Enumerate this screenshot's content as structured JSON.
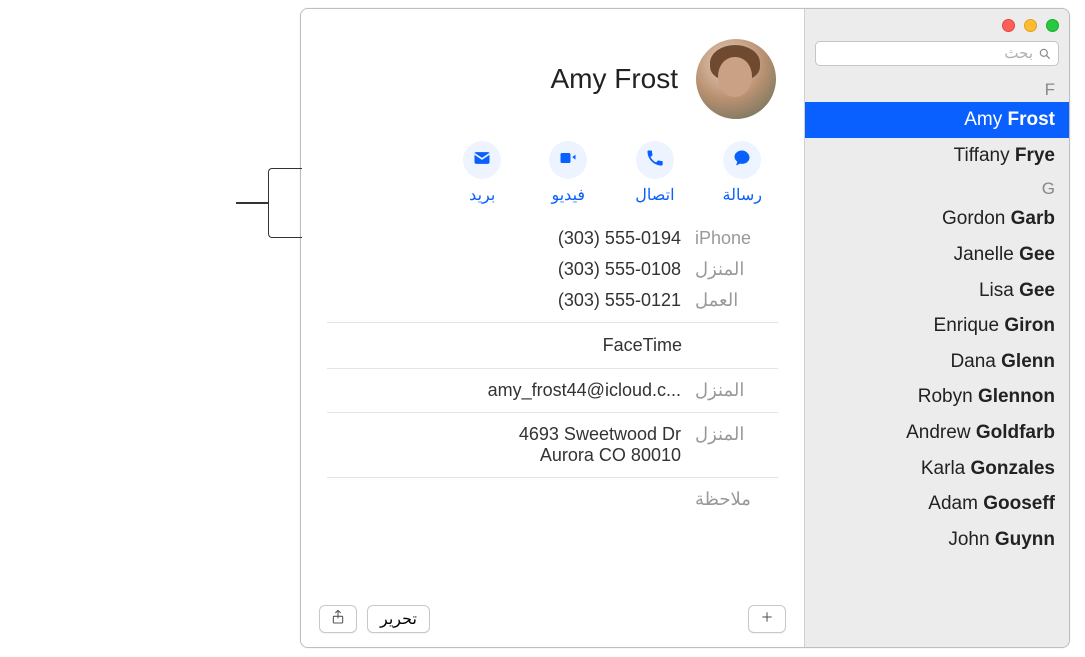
{
  "search": {
    "placeholder": "بحث"
  },
  "sections": [
    {
      "letter": "F",
      "contacts": [
        {
          "first": "Amy",
          "last": "Frost",
          "selected": true
        },
        {
          "first": "Tiffany",
          "last": "Frye",
          "selected": false
        }
      ]
    },
    {
      "letter": "G",
      "contacts": [
        {
          "first": "Gordon",
          "last": "Garb"
        },
        {
          "first": "Janelle",
          "last": "Gee"
        },
        {
          "first": "Lisa",
          "last": "Gee"
        },
        {
          "first": "Enrique",
          "last": "Giron"
        },
        {
          "first": "Dana",
          "last": "Glenn"
        },
        {
          "first": "Robyn",
          "last": "Glennon"
        },
        {
          "first": "Andrew",
          "last": "Goldfarb"
        },
        {
          "first": "Karla",
          "last": "Gonzales"
        },
        {
          "first": "Adam",
          "last": "Gooseff"
        },
        {
          "first": "John",
          "last": "Guynn"
        }
      ]
    }
  ],
  "detail": {
    "name": "Amy Frost",
    "actions": {
      "message": "رسالة",
      "call": "اتصال",
      "video": "فيديو",
      "mail": "بريد"
    },
    "phones": [
      {
        "label": "iPhone",
        "value": "(303) 555-0194"
      },
      {
        "label": "المنزل",
        "value": "(303) 555-0108"
      },
      {
        "label": "العمل",
        "value": "(303) 555-0121"
      }
    ],
    "facetime": "FaceTime",
    "email": {
      "label": "المنزل",
      "value": "amy_frost44@icloud.c..."
    },
    "address": {
      "label": "المنزل",
      "line1": "4693 Sweetwood Dr",
      "line2": "Aurora CO 80010"
    },
    "note_label": "ملاحظة"
  },
  "toolbar": {
    "edit": "تحرير"
  }
}
